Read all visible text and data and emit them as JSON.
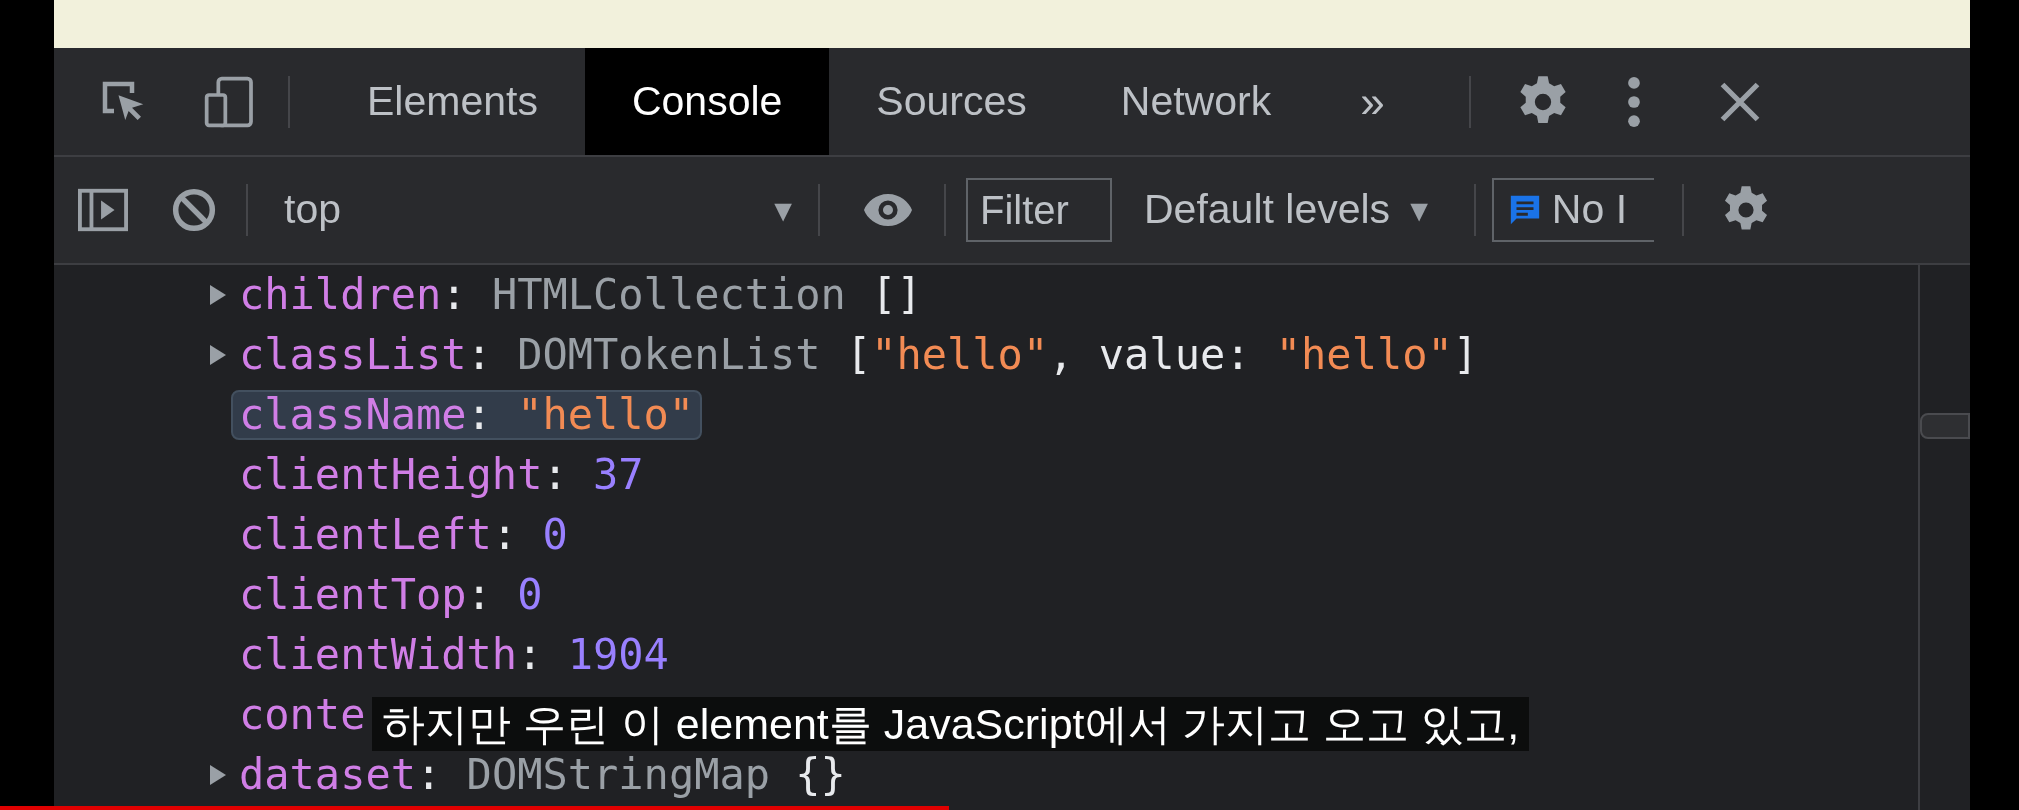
{
  "tabs_bar": {
    "tabs": [
      {
        "label": "Elements",
        "selected": false
      },
      {
        "label": "Console",
        "selected": true
      },
      {
        "label": "Sources",
        "selected": false
      },
      {
        "label": "Network",
        "selected": false
      }
    ],
    "more": "»"
  },
  "console_toolbar": {
    "context": "top",
    "context_caret": "▼",
    "filter": {
      "placeholder": "Filter"
    },
    "levels": "Default levels",
    "levels_caret": "▼",
    "issues": "No I"
  },
  "properties": [
    {
      "key": "children",
      "expandable": true,
      "highlighted": false,
      "parts": [
        {
          "kind": "punct",
          "text": ": "
        },
        {
          "kind": "type",
          "text": "HTMLCollection "
        },
        {
          "kind": "punct",
          "text": "[]"
        }
      ]
    },
    {
      "key": "classList",
      "expandable": true,
      "highlighted": false,
      "parts": [
        {
          "kind": "punct",
          "text": ": "
        },
        {
          "kind": "type",
          "text": "DOMTokenList "
        },
        {
          "kind": "punct",
          "text": "["
        },
        {
          "kind": "string",
          "text": "\"hello\""
        },
        {
          "kind": "punct",
          "text": ", value: "
        },
        {
          "kind": "string",
          "text": "\"hello\""
        },
        {
          "kind": "punct",
          "text": "]"
        }
      ]
    },
    {
      "key": "className",
      "expandable": false,
      "highlighted": true,
      "parts": [
        {
          "kind": "punct",
          "text": ": "
        },
        {
          "kind": "string",
          "text": "\"hello\""
        }
      ]
    },
    {
      "key": "clientHeight",
      "expandable": false,
      "highlighted": false,
      "parts": [
        {
          "kind": "punct",
          "text": ": "
        },
        {
          "kind": "number",
          "text": "37"
        }
      ]
    },
    {
      "key": "clientLeft",
      "expandable": false,
      "highlighted": false,
      "parts": [
        {
          "kind": "punct",
          "text": ": "
        },
        {
          "kind": "number",
          "text": "0"
        }
      ]
    },
    {
      "key": "clientTop",
      "expandable": false,
      "highlighted": false,
      "parts": [
        {
          "kind": "punct",
          "text": ": "
        },
        {
          "kind": "number",
          "text": "0"
        }
      ]
    },
    {
      "key": "clientWidth",
      "expandable": false,
      "highlighted": false,
      "parts": [
        {
          "kind": "punct",
          "text": ": "
        },
        {
          "kind": "number",
          "text": "1904"
        }
      ]
    },
    {
      "key": "conte",
      "expandable": false,
      "highlighted": false
    },
    {
      "key": "dataset",
      "expandable": true,
      "highlighted": false,
      "parts": [
        {
          "kind": "punct",
          "text": ": "
        },
        {
          "kind": "type",
          "text": "DOMStringMap "
        },
        {
          "kind": "punct",
          "text": "{}"
        }
      ]
    }
  ],
  "subtitle": "하지만 우린 이 element를 JavaScript에서 가지고 오고 있고,",
  "video_progress": {
    "level": 0.47
  }
}
